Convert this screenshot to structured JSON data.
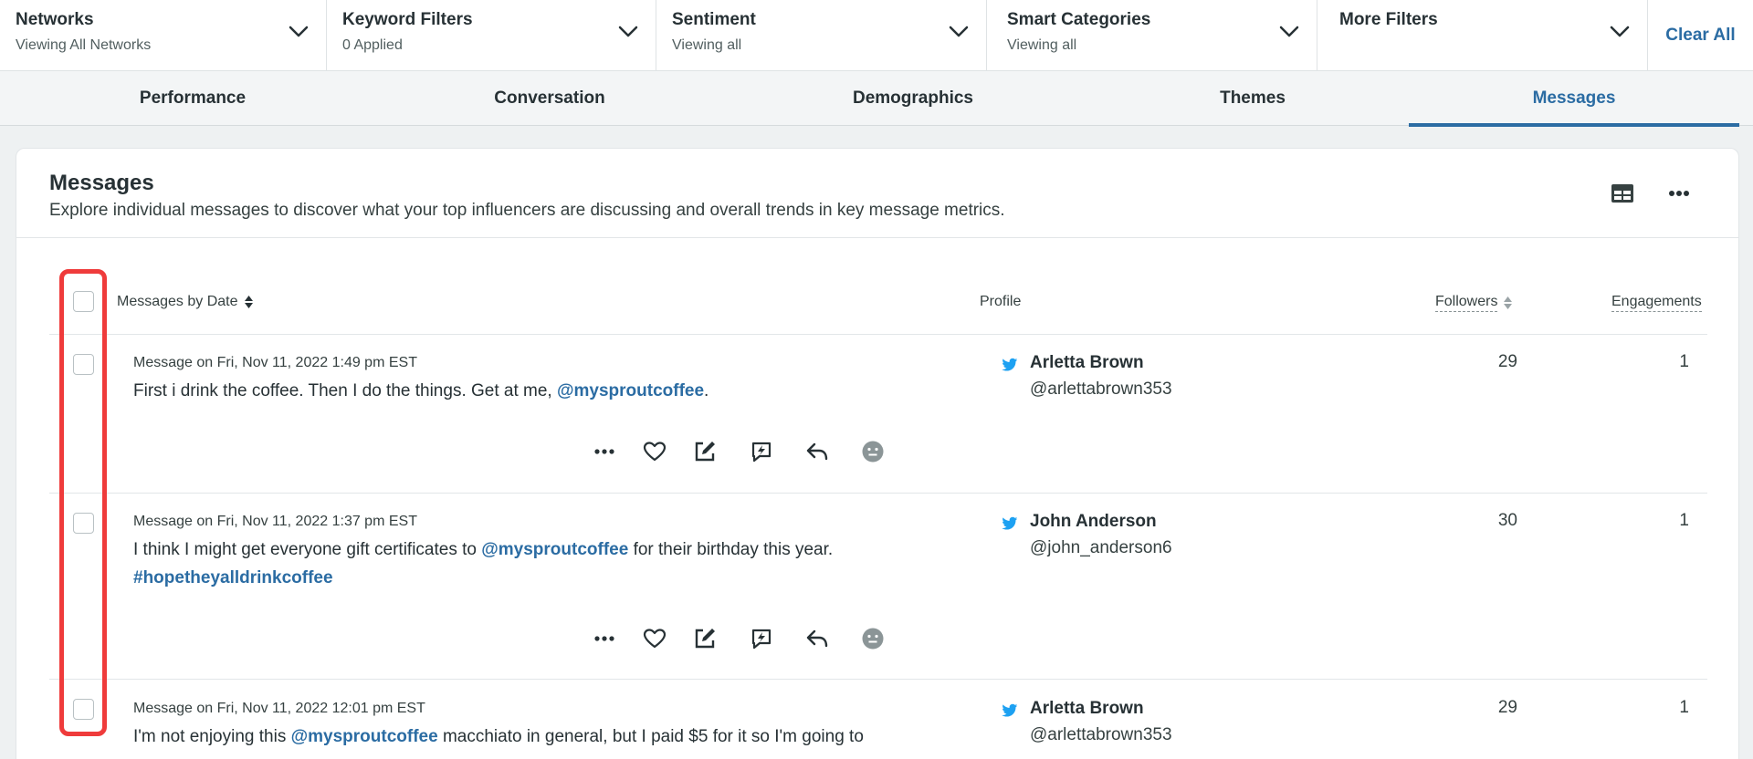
{
  "filters": [
    {
      "title": "Networks",
      "subtitle": "Viewing All Networks"
    },
    {
      "title": "Keyword Filters",
      "subtitle": "0 Applied"
    },
    {
      "title": "Sentiment",
      "subtitle": "Viewing all"
    },
    {
      "title": "Smart Categories",
      "subtitle": "Viewing all"
    },
    {
      "title": "More Filters",
      "subtitle": ""
    }
  ],
  "clear_all": "Clear All",
  "tabs": [
    "Performance",
    "Conversation",
    "Demographics",
    "Themes",
    "Messages"
  ],
  "active_tab": "Messages",
  "card": {
    "title": "Messages",
    "description": "Explore individual messages to discover what your top influencers are discussing and overall trends in key message metrics."
  },
  "table": {
    "col_messages": "Messages by Date",
    "col_profile": "Profile",
    "col_followers": "Followers",
    "col_engagements": "Engagements"
  },
  "rows": [
    {
      "meta": "Message on Fri, Nov 11, 2022 1:49 pm EST",
      "text_before": "First i drink the coffee. Then I do the things. Get at me, ",
      "mention": "@mysproutcoffee",
      "text_after": ".",
      "name": "Arletta Brown",
      "handle": "@arlettabrown353",
      "followers": "29",
      "engagements": "1"
    },
    {
      "meta": "Message on Fri, Nov 11, 2022 1:37 pm EST",
      "text_before": "I think I might get everyone gift certificates to ",
      "mention": "@mysproutcoffee",
      "text_after": " for their birthday this year.",
      "hashtag": "#hopetheyalldrinkcoffee",
      "name": "John Anderson",
      "handle": "@john_anderson6",
      "followers": "30",
      "engagements": "1"
    },
    {
      "meta": "Message on Fri, Nov 11, 2022 12:01 pm EST",
      "text_before": "I'm not enjoying this ",
      "mention": "@mysproutcoffee",
      "text_after": " macchiato in general, but I paid $5 for it so I'm going to",
      "name": "Arletta Brown",
      "handle": "@arlettabrown353",
      "followers": "29",
      "engagements": "1"
    }
  ],
  "colors": {
    "accent": "#2b6ca3",
    "highlight": "#ef3b3b",
    "twitter": "#1da1f2"
  },
  "icons": [
    "chevron-down-icon",
    "table-view-icon",
    "more-icon",
    "ellipsis-icon",
    "heart-icon",
    "edit-icon",
    "quick-reply-icon",
    "reply-icon",
    "sentiment-neutral-icon",
    "twitter-icon",
    "sort-icon"
  ]
}
